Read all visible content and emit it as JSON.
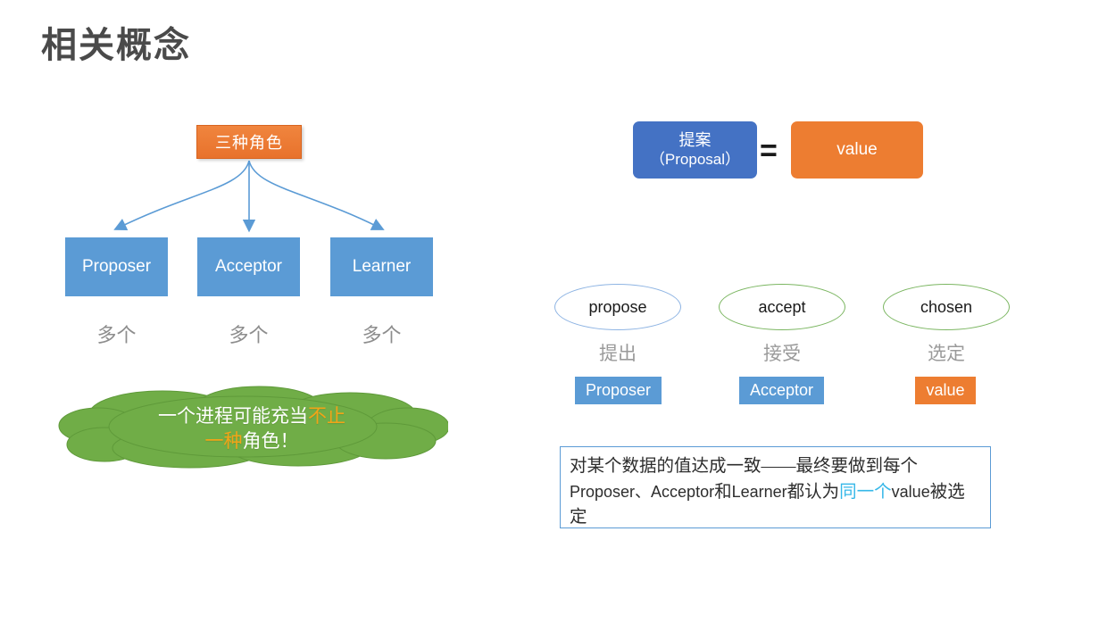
{
  "slide": {
    "title": "相关概念",
    "background": "#ffffff"
  },
  "colors": {
    "orange": "#ED7D31",
    "orange_dark": "#E8722C",
    "blue": "#5B9BD5",
    "blue_dark": "#4472C4",
    "green": "#70AD47",
    "green_outline": "#7BB661",
    "blue_outline": "#8EB4E3",
    "cyan_highlight": "#35B7E8",
    "amber_highlight": "#F2A417",
    "gray_text": "#8D8D8D",
    "title_gray": "#4A4A4A"
  },
  "left_diagram": {
    "head": {
      "label": "三种角色"
    },
    "roles": [
      {
        "name": "Proposer",
        "count_label": "多个"
      },
      {
        "name": "Acceptor",
        "count_label": "多个"
      },
      {
        "name": "Learner",
        "count_label": "多个"
      }
    ],
    "arrow_count": 3,
    "cloud": {
      "line1_a": "一个进程可能充当",
      "line1_b": "不止",
      "line2_a": "一种",
      "line2_b": "角色！"
    }
  },
  "right_diagram": {
    "equation": {
      "left_line1": "提案",
      "left_line2": "（Proposal）",
      "operator": "=",
      "right": "value"
    },
    "steps": [
      {
        "term": "propose",
        "cn": "提出",
        "actor": "Proposer",
        "outline": "blue",
        "tag_color": "#5B9BD5"
      },
      {
        "term": "accept",
        "cn": "接受",
        "actor": "Acceptor",
        "outline": "green",
        "tag_color": "#5B9BD5"
      },
      {
        "term": "chosen",
        "cn": "选定",
        "actor": "value",
        "outline": "green",
        "tag_color": "#ED7D31"
      }
    ],
    "note": {
      "seg1": "对某个数据的值达成一致——最终要做到每个",
      "seg2": "Proposer、Acceptor",
      "seg3": "和",
      "seg4": "Learner",
      "seg5": "都认为",
      "seg6_highlight": "同一个",
      "seg7": "value",
      "seg8": "被选定"
    }
  }
}
